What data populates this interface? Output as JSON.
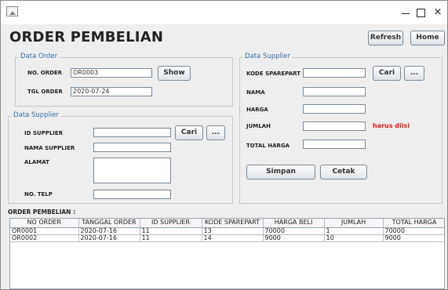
{
  "window": {
    "min_icon": "minimize-icon",
    "max_icon": "maximize-icon",
    "close_glyph": "×"
  },
  "header": {
    "title": "ORDER PEMBELIAN",
    "refresh_label": "Refresh",
    "home_label": "Home"
  },
  "data_order": {
    "legend": "Data Order",
    "no_order_label": "NO. ORDER",
    "no_order_value": "OR0003",
    "show_label": "Show",
    "tgl_order_label": "TGL ORDER",
    "tgl_order_value": "2020-07-24"
  },
  "data_supplier_left": {
    "legend": "Data Supplier",
    "id_label": "ID SUPPLIER",
    "id_value": "",
    "cari_label": "Cari",
    "more_label": "...",
    "nama_label": "NAMA SUPPLIER",
    "nama_value": "",
    "alamat_label": "ALAMAT",
    "telp_label": "NO. TELP",
    "telp_value": ""
  },
  "data_supplier_right": {
    "legend": "Data Supplier",
    "kode_label": "KODE SPAREPART",
    "kode_value": "",
    "cari_label": "Cari",
    "more_label": "...",
    "nama_label": "NAMA",
    "harga_label": "HARGA",
    "jumlah_label": "JUMLAH",
    "warning": "harus diisi",
    "total_label": "TOTAL HARGA",
    "simpan_label": "Simpan",
    "cetak_label": "Cetak"
  },
  "colors": {
    "legend": "#3a6ea5",
    "warning": "#e21a1a"
  },
  "table": {
    "caption": "ORDER PEMBELIAN :",
    "headers": [
      "NO ORDER",
      "TANGGAL ORDER",
      "ID SUPPLIER",
      "KODE SPAREPART",
      "HARGA BELI",
      "JUMLAH",
      "TOTAL HARGA"
    ],
    "rows": [
      [
        "OR0001",
        "2020-07-16",
        "11",
        "13",
        "70000",
        "1",
        "70000"
      ],
      [
        "OR0002",
        "2020-07-16",
        "11",
        "14",
        "9000",
        "10",
        "9000"
      ]
    ]
  }
}
